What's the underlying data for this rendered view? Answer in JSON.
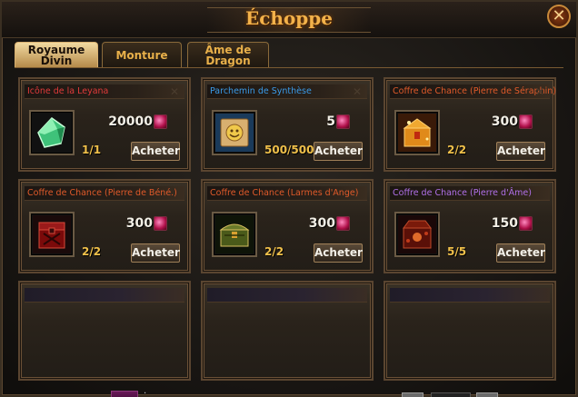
{
  "window": {
    "title": "Échoppe",
    "close_label": "✕"
  },
  "tabs": [
    {
      "label": "Royaume Divin",
      "active": true
    },
    {
      "label": "Monture",
      "active": false
    },
    {
      "label": "Âme de Dragon",
      "active": false
    }
  ],
  "items": [
    {
      "name": "Icône de la Leyana",
      "name_color": "#e03a3a",
      "price": "20000",
      "stock": "1/1",
      "buy_label": "Acheter",
      "icon": "green-gem-icon"
    },
    {
      "name": "Parchemin de Synthèse",
      "name_color": "#3a9ae8",
      "price": "5",
      "stock": "500/500",
      "buy_label": "Acheter",
      "icon": "scroll-icon"
    },
    {
      "name": "Coffre de Chance (Pierre de Séraphin)",
      "name_color": "#e05a2a",
      "price": "300",
      "stock": "2/2",
      "buy_label": "Acheter",
      "icon": "golden-chest-icon"
    },
    {
      "name": "Coffre de Chance (Pierre de Béné.)",
      "name_color": "#e05a2a",
      "price": "300",
      "stock": "2/2",
      "buy_label": "Acheter",
      "icon": "red-chest-icon"
    },
    {
      "name": "Coffre de Chance (Larmes d'Ange)",
      "name_color": "#e05a2a",
      "price": "300",
      "stock": "2/2",
      "buy_label": "Acheter",
      "icon": "green-chest-icon"
    },
    {
      "name": "Coffre de Chance (Pierre d'Âme)",
      "name_color": "#b070e8",
      "price": "150",
      "stock": "5/5",
      "buy_label": "Acheter",
      "icon": "dark-red-chest-icon"
    }
  ],
  "currency_icon": "pink-crystal-icon"
}
